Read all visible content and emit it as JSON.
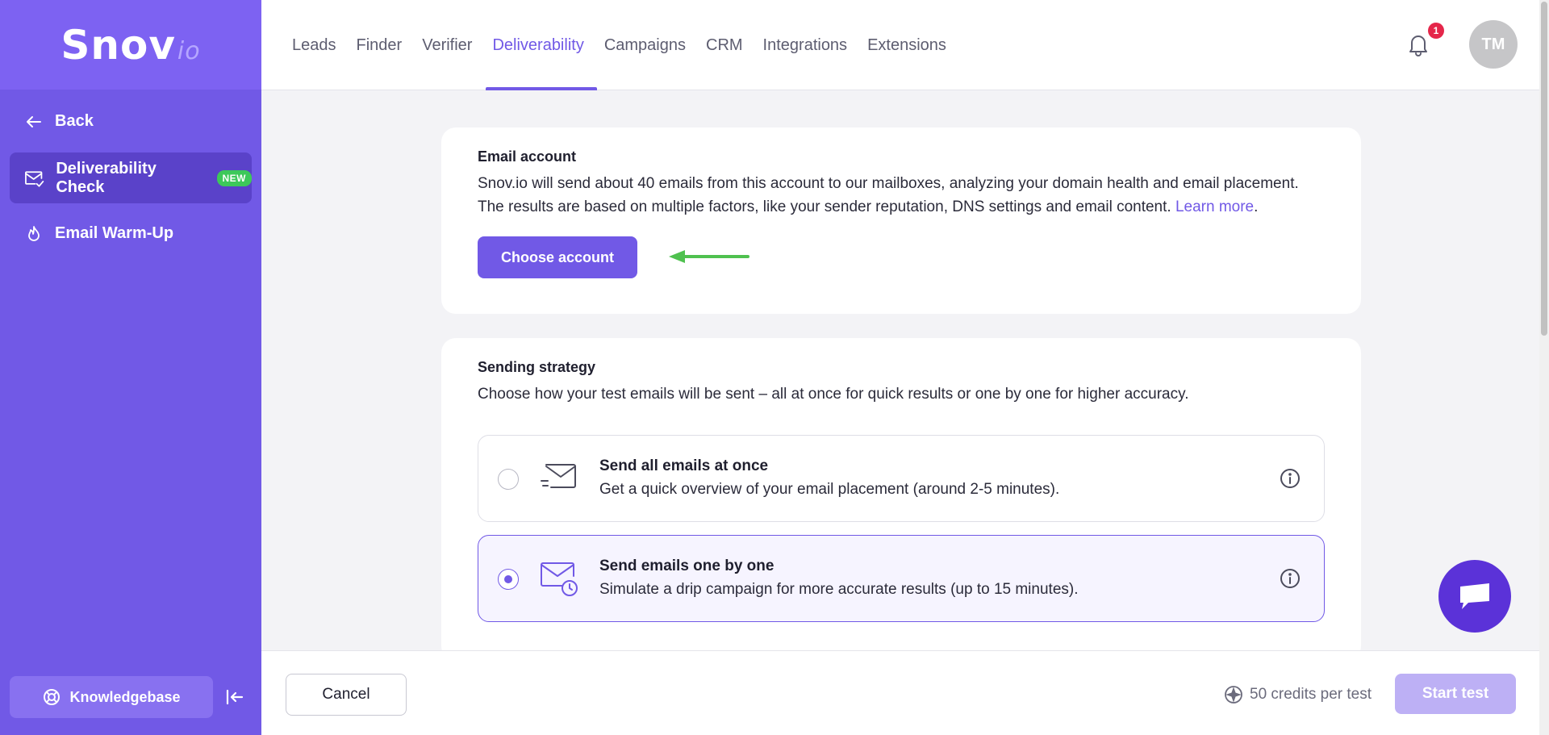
{
  "logo": {
    "main": "Snov",
    "suffix": "io"
  },
  "sidebar": {
    "back_label": "Back",
    "items": [
      {
        "label": "Deliverability Check",
        "badge": "NEW",
        "icon": "mail-check-icon",
        "active": true
      },
      {
        "label": "Email Warm-Up",
        "icon": "flame-icon",
        "active": false
      }
    ],
    "knowledgebase_label": "Knowledgebase"
  },
  "nav": {
    "items": [
      "Leads",
      "Finder",
      "Verifier",
      "Deliverability",
      "Campaigns",
      "CRM",
      "Integrations",
      "Extensions"
    ],
    "active": "Deliverability"
  },
  "header": {
    "notification_count": "1",
    "avatar_initials": "TM"
  },
  "email_account": {
    "title": "Email account",
    "text_line1": "Snov.io will send about 40 emails from this account to our mailboxes, analyzing your domain health and email placement.",
    "text_line2": "The results are based on multiple factors, like your sender reputation, DNS settings and email content.",
    "learn_more": "Learn more",
    "period": ".",
    "button": "Choose account"
  },
  "sending_strategy": {
    "title": "Sending strategy",
    "description": "Choose how your test emails will be sent – all at once for quick results or one by one for higher accuracy.",
    "options": [
      {
        "title": "Send all emails at once",
        "description": "Get a quick overview of your email placement (around 2-5 minutes).",
        "icon": "envelope-fast-icon",
        "selected": false
      },
      {
        "title": "Send emails one by one",
        "description": "Simulate a drip campaign for more accurate results (up to 15 minutes).",
        "icon": "envelope-clock-icon",
        "selected": true
      }
    ]
  },
  "footer": {
    "cancel": "Cancel",
    "credits": "50 credits per test",
    "start": "Start test"
  },
  "colors": {
    "accent": "#7159e6",
    "sidebar": "#7159e6",
    "badge_green": "#3dc85a",
    "arrow_green": "#4fc14f",
    "notification_red": "#e5264a"
  }
}
